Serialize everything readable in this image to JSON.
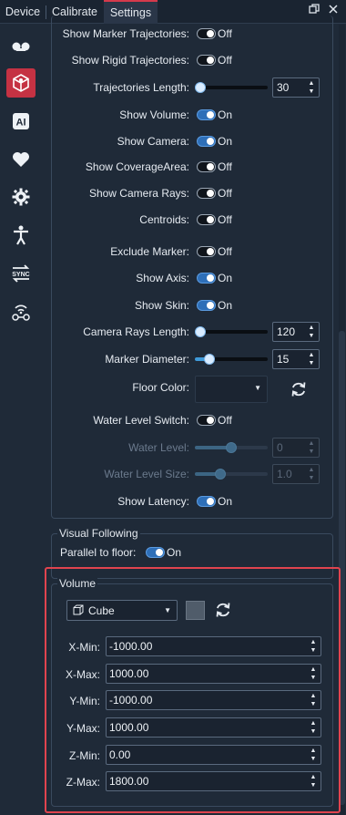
{
  "tabs": [
    {
      "label": "Device"
    },
    {
      "label": "Calibrate"
    },
    {
      "label": "Settings",
      "active": true
    }
  ],
  "window_buttons": [
    "restore-icon",
    "close-icon"
  ],
  "sidebar": {
    "items": [
      {
        "icon": "tape-icon"
      },
      {
        "icon": "model-icon",
        "active": true
      },
      {
        "icon": "ai-icon"
      },
      {
        "icon": "heart-icon"
      },
      {
        "icon": "gear-icon"
      },
      {
        "icon": "person-icon"
      },
      {
        "icon": "sync-icon"
      },
      {
        "icon": "wireless-icon"
      }
    ]
  },
  "settings": {
    "show_marker_trajectories": {
      "label": "Show Marker Trajectories:",
      "state": "Off"
    },
    "show_rigid_trajectories": {
      "label": "Show Rigid Trajectories:",
      "state": "Off"
    },
    "trajectories_length": {
      "label": "Trajectories Length:",
      "value": "30",
      "fraction": 0.03
    },
    "show_volume": {
      "label": "Show Volume:",
      "state": "On"
    },
    "show_camera": {
      "label": "Show Camera:",
      "state": "On"
    },
    "show_coverage_area": {
      "label": "Show CoverageArea:",
      "state": "Off"
    },
    "show_camera_rays": {
      "label": "Show Camera Rays:",
      "state": "Off"
    },
    "centroids": {
      "label": "Centroids:",
      "state": "Off"
    },
    "exclude_marker": {
      "label": "Exclude Marker:",
      "state": "Off"
    },
    "show_axis": {
      "label": "Show Axis:",
      "state": "On"
    },
    "show_skin": {
      "label": "Show Skin:",
      "state": "On"
    },
    "camera_rays_length": {
      "label": "Camera Rays Length:",
      "value": "120",
      "fraction": 0.03
    },
    "marker_diameter": {
      "label": "Marker Diameter:",
      "value": "15",
      "fraction": 0.18
    },
    "floor_color": {
      "label": "Floor Color:"
    },
    "water_level_switch": {
      "label": "Water Level Switch:",
      "state": "Off"
    },
    "water_level": {
      "label": "Water Level:",
      "value": "0",
      "fraction": 0.5
    },
    "water_level_size": {
      "label": "Water Level Size:",
      "value": "1.0",
      "fraction": 0.35
    },
    "show_latency": {
      "label": "Show Latency:",
      "state": "On"
    }
  },
  "visual_following": {
    "title": "Visual Following",
    "parallel_to_floor": {
      "label": "Parallel to floor:",
      "state": "On"
    }
  },
  "volume": {
    "title": "Volume",
    "shape": "Cube",
    "x_min": {
      "label": "X-Min:",
      "value": "-1000.00"
    },
    "x_max": {
      "label": "X-Max:",
      "value": "1000.00"
    },
    "y_min": {
      "label": "Y-Min:",
      "value": "-1000.00"
    },
    "y_max": {
      "label": "Y-Max:",
      "value": "1000.00"
    },
    "z_min": {
      "label": "Z-Min:",
      "value": "0.00"
    },
    "z_max": {
      "label": "Z-Max:",
      "value": "1800.00"
    }
  },
  "colors": {
    "accent": "#c53243",
    "toggle_on": "#2e6fb8",
    "highlight_border": "#e0444f"
  }
}
